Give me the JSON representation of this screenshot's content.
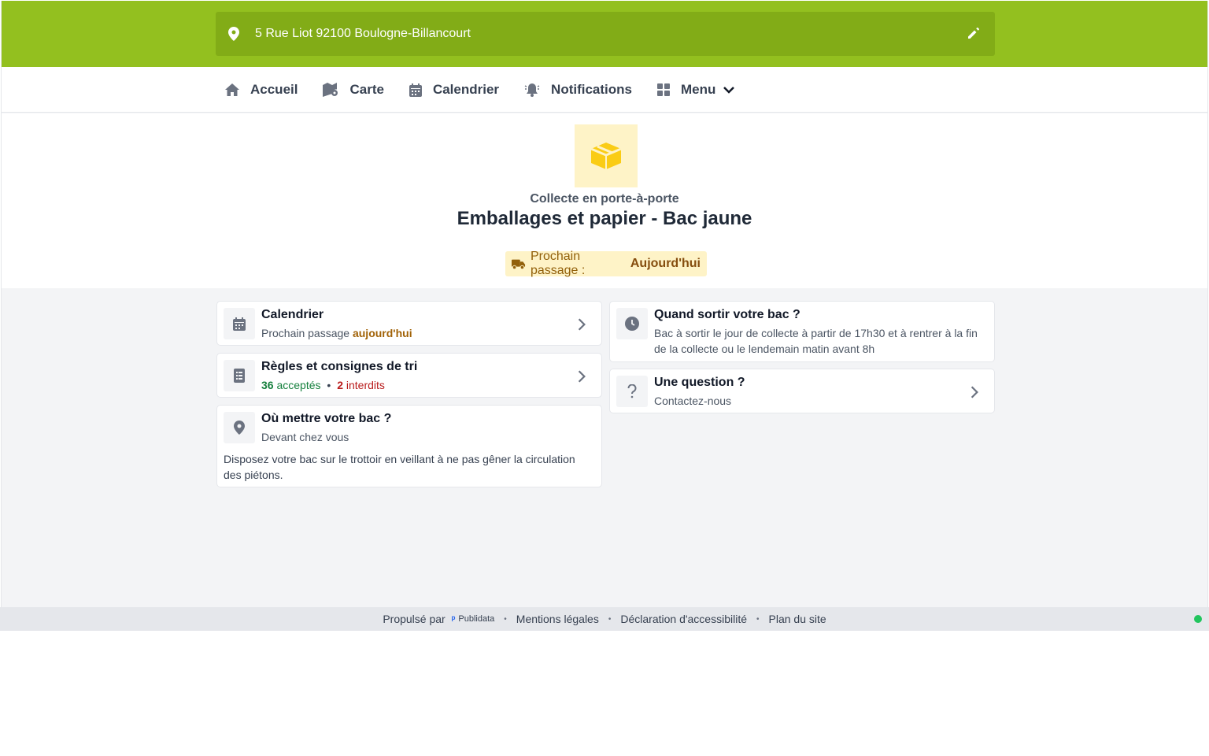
{
  "header": {
    "address": "5 Rue Liot 92100 Boulogne-Billancourt"
  },
  "nav": {
    "items": [
      {
        "label": "Accueil",
        "icon": "home-icon"
      },
      {
        "label": "Carte",
        "icon": "map-icon"
      },
      {
        "label": "Calendrier",
        "icon": "calendar-icon"
      },
      {
        "label": "Notifications",
        "icon": "bell-icon"
      },
      {
        "label": "Menu",
        "icon": "grid-icon"
      }
    ]
  },
  "hero": {
    "icon": "box-icon",
    "subtitle": "Collecte en porte-à-porte",
    "title": "Emballages et papier - Bac jaune",
    "badge_label": "Prochain passage :",
    "badge_value": "Aujourd'hui"
  },
  "cards": {
    "calendar": {
      "title": "Calendrier",
      "sub_prefix": "Prochain passage",
      "sub_value": "aujourd'hui"
    },
    "rules": {
      "title": "Règles et consignes de tri",
      "accepted_count": "36",
      "accepted_label": "acceptés",
      "forbidden_count": "2",
      "forbidden_label": "interdits"
    },
    "where": {
      "title": "Où mettre votre bac ?",
      "subtitle": "Devant chez vous",
      "body": "Disposez votre bac sur le trottoir en veillant à ne pas gêner la circulation des piétons."
    },
    "when": {
      "title": "Quand sortir votre bac ?",
      "body": "Bac à sortir le jour de collecte à partir de 17h30 et à rentrer à la fin de la collecte ou le lendemain matin avant 8h"
    },
    "question": {
      "title": "Une question ?",
      "subtitle": "Contactez-nous"
    }
  },
  "footer": {
    "powered_by": "Propulsé par",
    "brand": "Publidata",
    "links": [
      "Mentions légales",
      "Déclaration d'accessibilité",
      "Plan du site"
    ]
  },
  "colors": {
    "brand_green": "#93c01f",
    "address_bg": "#82ac17",
    "accent_yellow": "#facc15",
    "status_green": "#22c55e"
  }
}
